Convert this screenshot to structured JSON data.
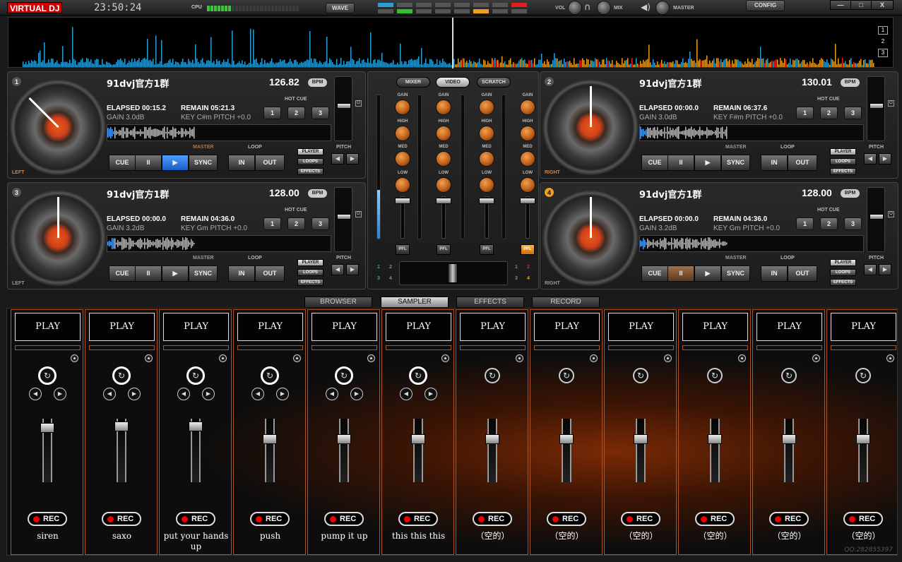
{
  "app": {
    "logo": "VIRTUAL DJ",
    "clock": "23:50:24",
    "cpu_label": "CPU",
    "cpu_load": 0.28
  },
  "toolbar": {
    "wave": "WAVE",
    "vol": "VOL",
    "mix": "MIX",
    "master": "MASTER",
    "config": "CONFIG",
    "minimize": "—",
    "maximize": "□",
    "close": "X"
  },
  "overview": {
    "deck_numbers": [
      "1",
      "2",
      "3"
    ],
    "colors": {
      "left": "#2a9fd6",
      "right": "#e8a020",
      "accent": "#e02020"
    }
  },
  "decks": [
    {
      "number": "1",
      "title": "91dvj官方1群",
      "bpm": "126.82",
      "bpm_tag": "BPM",
      "elapsed": "ELAPSED 00:15.2",
      "gain": "GAIN 3.0dB",
      "remain": "REMAIN 05:21.3",
      "key_pitch": "KEY C#m  PITCH +0.0",
      "side": "LEFT",
      "master": "MASTER",
      "state": "playing"
    },
    {
      "number": "2",
      "title": "91dvj官方1群",
      "bpm": "130.01",
      "bpm_tag": "BPM",
      "elapsed": "ELAPSED 00:00.0",
      "gain": "GAIN 3.0dB",
      "remain": "REMAIN 06:37.6",
      "key_pitch": "KEY F#m  PITCH +0.0",
      "side": "RIGHT",
      "master": "MASTER",
      "state": "stopped"
    },
    {
      "number": "3",
      "title": "91dvj官方1群",
      "bpm": "128.00",
      "bpm_tag": "BPM",
      "elapsed": "ELAPSED 00:00.0",
      "gain": "GAIN 3.2dB",
      "remain": "REMAIN 04:36.0",
      "key_pitch": "KEY Gm   PITCH +0.0",
      "side": "LEFT",
      "master": "MASTER",
      "state": "stopped"
    },
    {
      "number": "4",
      "title": "91dvj官方1群",
      "bpm": "128.00",
      "bpm_tag": "BPM",
      "elapsed": "ELAPSED 00:00.0",
      "gain": "GAIN 3.2dB",
      "remain": "REMAIN 04:36.0",
      "key_pitch": "KEY Gm   PITCH +0.0",
      "side": "RIGHT",
      "master": "MASTER",
      "state": "paused"
    }
  ],
  "deck_controls": {
    "hot_cue": "HOT CUE",
    "loop": "LOOP",
    "pitch": "PITCH",
    "cue": "CUE",
    "pause": "II",
    "play": "▶",
    "sync": "SYNC",
    "in": "IN",
    "out": "OUT",
    "hc1": "1",
    "hc2": "2",
    "hc3": "3",
    "player": "PLAYER",
    "loops": "LOOPS",
    "effects": "EFFECTS",
    "left_arrow": "◀",
    "right_arrow": "▶",
    "o": "O"
  },
  "mixer": {
    "tabs": [
      "MIXER",
      "VIDEO",
      "SCRATCH"
    ],
    "gain": "GAIN",
    "high": "HIGH",
    "med": "MED",
    "low": "LOW",
    "pfl": "PFL",
    "xfader_left": [
      "1",
      "2",
      "3",
      "4"
    ],
    "xfader_right": [
      "1",
      "2",
      "3",
      "4"
    ]
  },
  "bottom_tabs": [
    "BROWSER",
    "SAMPLER",
    "EFFECTS",
    "RECORD"
  ],
  "sampler": {
    "play": "PLAY",
    "rec": "REC",
    "slots": [
      {
        "name": "siren"
      },
      {
        "name": "saxo"
      },
      {
        "name": "put your hands up"
      },
      {
        "name": "push"
      },
      {
        "name": "pump it up"
      },
      {
        "name": "this this this"
      },
      {
        "name": "（空的）"
      },
      {
        "name": "（空的）"
      },
      {
        "name": "（空的）"
      },
      {
        "name": "（空的）"
      },
      {
        "name": "（空的）"
      },
      {
        "name": "（空的）"
      }
    ],
    "watermark": "QQ:282855397"
  }
}
